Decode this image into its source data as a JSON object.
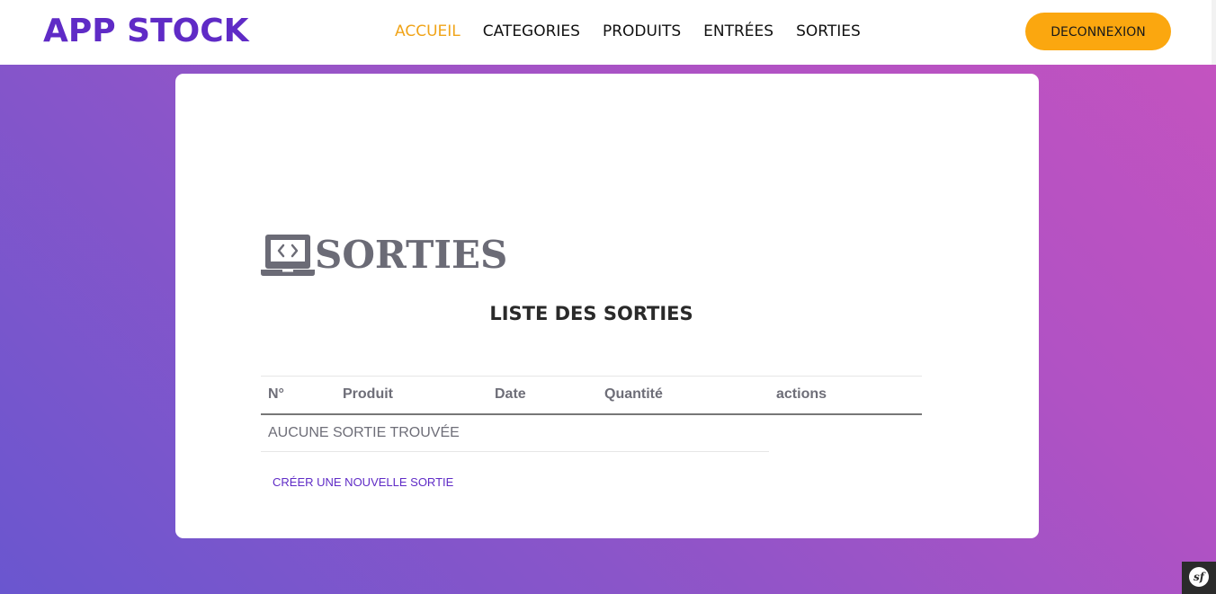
{
  "navbar": {
    "brand": "APP STOCK",
    "links": [
      {
        "label": "ACCUEIL",
        "active": true
      },
      {
        "label": "CATEGORIES",
        "active": false
      },
      {
        "label": "PRODUITS",
        "active": false
      },
      {
        "label": "ENTRÉES",
        "active": false
      },
      {
        "label": "SORTIES",
        "active": false
      }
    ],
    "logout_label": "DECONNEXION"
  },
  "main": {
    "page_title": "SORTIES",
    "page_icon": "laptop-code-icon",
    "list_title": "LISTE DES SORTIES",
    "table": {
      "columns": [
        "N°",
        "Produit",
        "Date",
        "Quantité",
        "actions"
      ],
      "empty_message": "AUCUNE SORTIE TROUVÉE"
    },
    "create_link": "CRÉER UNE NOUVELLE SORTIE"
  },
  "debug_toolbar": {
    "icon": "symfony-logo-icon",
    "logo_text": "sf"
  },
  "colors": {
    "brand": "#5f2bc6",
    "active_link": "#f0a419",
    "logout_button": "#fba70f",
    "heading_gray": "#6b6b76",
    "gradient_start": "#6a56cf",
    "gradient_end": "#c653bf"
  }
}
